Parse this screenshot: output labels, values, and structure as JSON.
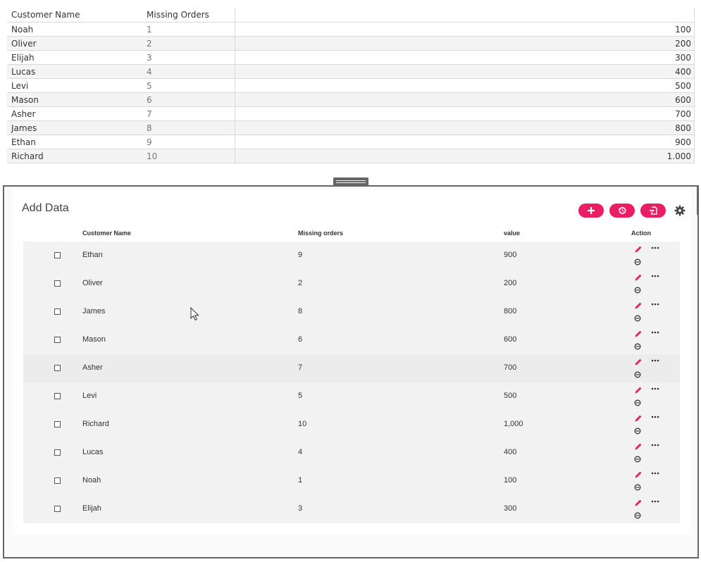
{
  "top_table": {
    "headers": [
      "Customer Name",
      "Missing Orders",
      ""
    ],
    "rows": [
      {
        "name": "Noah",
        "missing": "1",
        "value": "100"
      },
      {
        "name": "Oliver",
        "missing": "2",
        "value": "200"
      },
      {
        "name": "Elijah",
        "missing": "3",
        "value": "300"
      },
      {
        "name": "Lucas",
        "missing": "4",
        "value": "400"
      },
      {
        "name": "Levi",
        "missing": "5",
        "value": "500"
      },
      {
        "name": "Mason",
        "missing": "6",
        "value": "600"
      },
      {
        "name": "Asher",
        "missing": "7",
        "value": "700"
      },
      {
        "name": "James",
        "missing": "8",
        "value": "800"
      },
      {
        "name": "Ethan",
        "missing": "9",
        "value": "900"
      },
      {
        "name": "Richard",
        "missing": "10",
        "value": "1.000"
      }
    ]
  },
  "panel": {
    "title": "Add Data",
    "toolbar": {
      "add_icon": "plus-icon",
      "history_icon": "history-icon",
      "import_icon": "import-icon",
      "settings_icon": "gear-icon",
      "accent_color": "#e91e63"
    },
    "grid": {
      "headers": {
        "name": "Customer Name",
        "missing": "Missing orders",
        "value": "value",
        "action": "Action"
      },
      "rows": [
        {
          "name": "Ethan",
          "missing": "9",
          "value": "900"
        },
        {
          "name": "Oliver",
          "missing": "2",
          "value": "200"
        },
        {
          "name": "James",
          "missing": "8",
          "value": "800"
        },
        {
          "name": "Mason",
          "missing": "6",
          "value": "600"
        },
        {
          "name": "Asher",
          "missing": "7",
          "value": "700"
        },
        {
          "name": "Levi",
          "missing": "5",
          "value": "500"
        },
        {
          "name": "Richard",
          "missing": "10",
          "value": "1,000"
        },
        {
          "name": "Lucas",
          "missing": "4",
          "value": "400"
        },
        {
          "name": "Noah",
          "missing": "1",
          "value": "100"
        },
        {
          "name": "Elijah",
          "missing": "3",
          "value": "300"
        }
      ]
    }
  }
}
